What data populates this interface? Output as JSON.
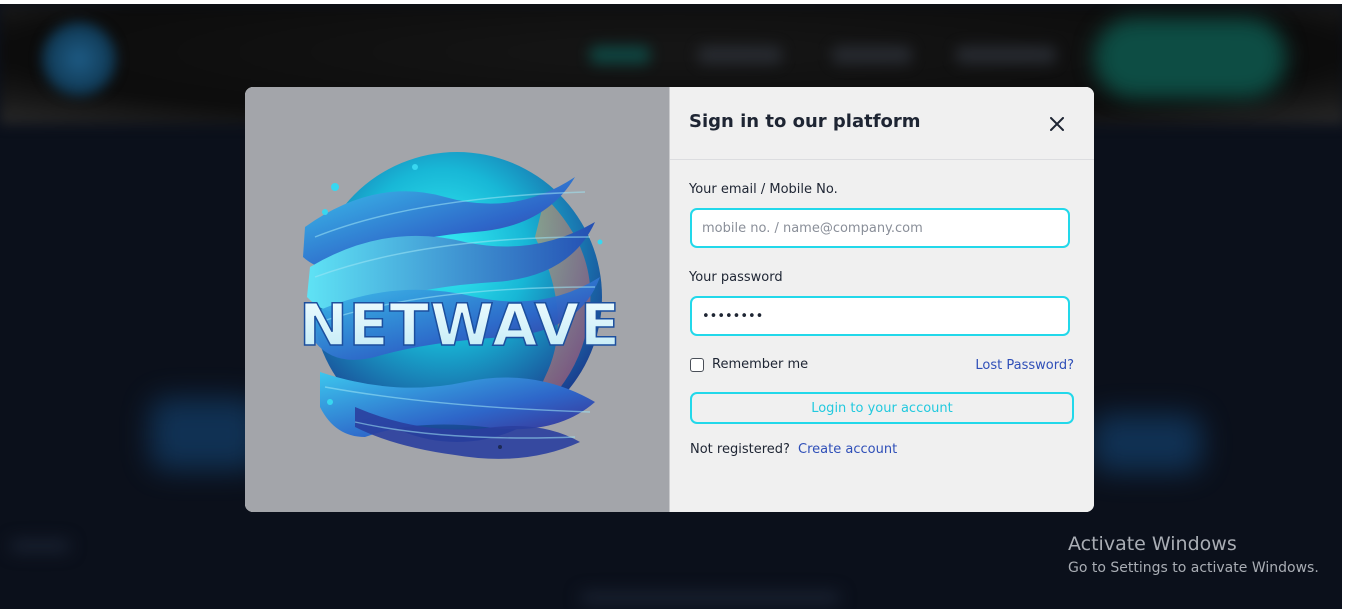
{
  "modal": {
    "title": "Sign in to our platform",
    "close_icon": "close-icon",
    "logo_text": "NETWAVE"
  },
  "form": {
    "email_label": "Your email / Mobile No.",
    "email_placeholder": "mobile no. / name@company.com",
    "email_value": "",
    "password_label": "Your password",
    "password_value": "••••••••",
    "remember_label": "Remember me",
    "remember_checked": false,
    "lost_password": "Lost Password?",
    "login_button": "Login to your account",
    "not_registered": "Not registered?",
    "create_account": "Create account"
  },
  "watermark": {
    "title": "Activate Windows",
    "subtitle": "Go to Settings to activate Windows."
  },
  "colors": {
    "accent": "#22d8ea",
    "link": "#2f4fb8",
    "modal_bg": "#f0f0f0",
    "panel_bg": "#a3a5aa"
  }
}
